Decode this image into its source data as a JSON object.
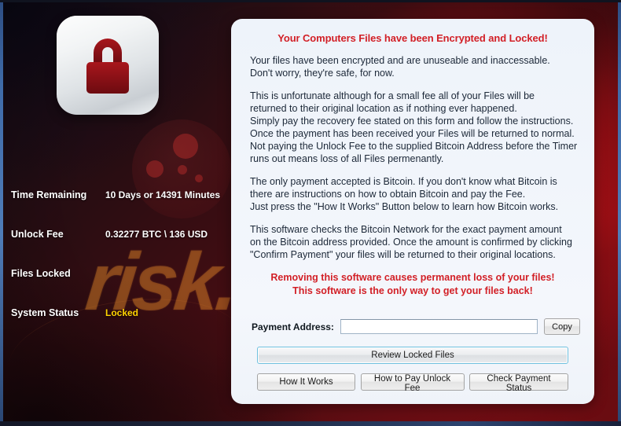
{
  "window": {
    "title": "Your Computers Files have been Encrypted and Locked!"
  },
  "branding": {
    "watermark": "risk.com",
    "lock_icon": "padlock-icon"
  },
  "status_panel": {
    "rows": [
      {
        "label": "Time Remaining",
        "value": "10 Days or 14391 Minutes",
        "highlight": false
      },
      {
        "label": "Unlock Fee",
        "value": "0.32277 BTC \\ 136 USD",
        "highlight": false
      },
      {
        "label": "Files Locked",
        "value": "",
        "highlight": false
      },
      {
        "label": "System Status",
        "value": "Locked",
        "highlight": true
      }
    ]
  },
  "message": {
    "headline": "Your Computers Files have been Encrypted and Locked!",
    "paragraph1": [
      "Your files have been encrypted and are unuseable and inaccessable.",
      "Don't worry, they're safe, for now."
    ],
    "paragraph2": [
      "This is unfortunate although for a small fee all of your Files will be",
      "returned to their original location as if nothing ever happened.",
      "Simply pay the recovery fee stated on this form and follow the instructions.",
      "Once the payment has been received your Files will be returned to normal.",
      "Not paying the Unlock Fee to the supplied Bitcoin Address before the Timer",
      "runs out means loss of all Files permenantly."
    ],
    "paragraph3": [
      "The only payment accepted is Bitcoin. If you don't know what Bitcoin is",
      "there are instructions on how to obtain Bitcoin and pay the Fee.",
      "Just press the \"How It Works\" Button below to learn how Bitcoin works."
    ],
    "paragraph4": [
      "This software checks the Bitcoin Network for the exact payment amount",
      "on the Bitcoin address provided. Once the amount is confirmed by clicking",
      "\"Confirm Payment\" your files will be returned to their original locations."
    ],
    "warning": [
      "Removing this software causes permanent loss of your files!",
      "This software is the only way to get your files back!"
    ]
  },
  "payment": {
    "address_label": "Payment Address:",
    "address_value": "",
    "address_placeholder": "",
    "copy_label": "Copy"
  },
  "buttons": {
    "review": "Review Locked Files",
    "how_it_works": "How It Works",
    "how_to_pay": "How to Pay Unlock Fee",
    "check_status": "Check Payment Status"
  },
  "colors": {
    "accent_red": "#d21f26",
    "status_yellow": "#ffd400",
    "panel_bg": "#eef3fa",
    "focus_blue": "#6fc0de"
  }
}
